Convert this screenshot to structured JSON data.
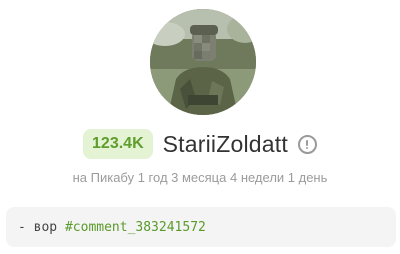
{
  "profile": {
    "avatar_icon": "user-avatar-photo",
    "rating": "123.4K",
    "username": "StariiZoldatt",
    "info_icon": "info-icon",
    "membership": "на Пикабу 1 год 3 месяца 4 недели 1 день",
    "about": {
      "prefix": "- вор ",
      "link_text": "#comment_383241572"
    }
  },
  "colors": {
    "rating_bg": "#e3f3d3",
    "rating_text": "#5f9d2e",
    "link": "#5a9a2a",
    "muted_text": "#9b9b9b"
  }
}
